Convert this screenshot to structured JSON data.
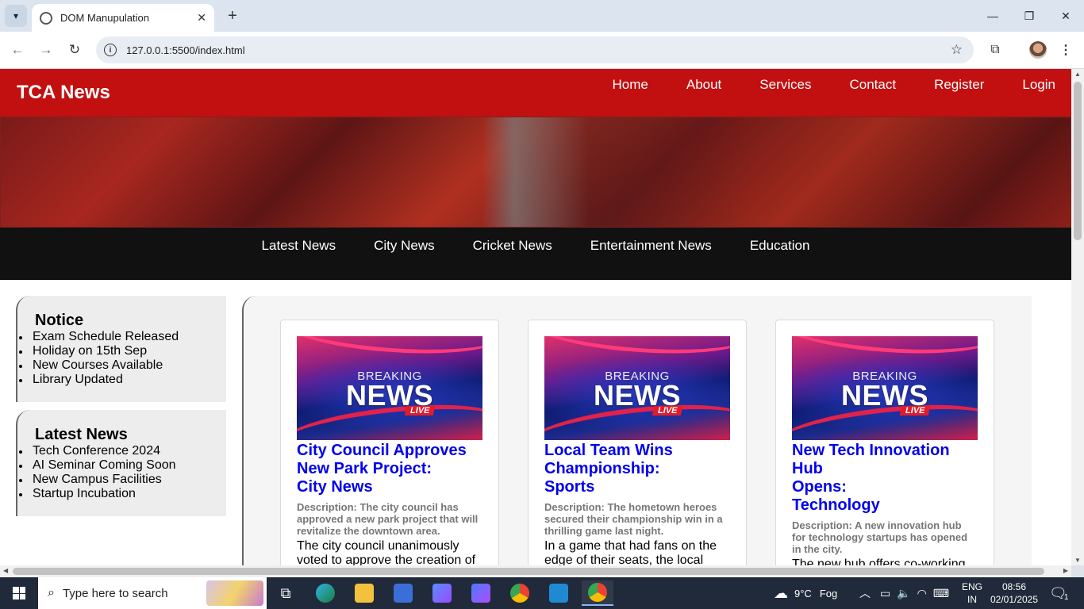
{
  "browser": {
    "tab_title": "DOM Manupulation",
    "url": "127.0.0.1:5500/index.html"
  },
  "site": {
    "logo": "TCA News",
    "main_nav": [
      "Home",
      "About",
      "Services",
      "Contact",
      "Register",
      "Login"
    ],
    "category_nav": [
      "Latest News",
      "City News",
      "Cricket News",
      "Entertainment News",
      "Education"
    ],
    "notice": {
      "title": "Notice",
      "items": [
        "Exam Schedule Released",
        "Holiday on 15th Sep",
        "New Courses Available",
        "Library Updated"
      ]
    },
    "latest": {
      "title": "Latest News",
      "items": [
        "Tech Conference 2024",
        "AI Seminar Coming Soon",
        "New Campus Facilities",
        "Startup Incubation"
      ]
    },
    "cards": [
      {
        "img_breaking": "BREAKING",
        "img_news": "NEWS",
        "img_live": "LIVE",
        "headline_line1": "City Council Approves",
        "headline_line2": "New Park Project:",
        "category": "City News",
        "description": "Description: The city council has approved a new park project that will revitalize the downtown area.",
        "body": "The city council unanimously voted to approve the creation of"
      },
      {
        "img_breaking": "BREAKING",
        "img_news": "NEWS",
        "img_live": "LIVE",
        "headline_line1": "Local Team Wins",
        "headline_line2": "Championship:",
        "category": "Sports",
        "description": "Description: The hometown heroes secured their championship win in a thrilling game last night.",
        "body": "In a game that had fans on the edge of their seats, the local"
      },
      {
        "img_breaking": "BREAKING",
        "img_news": "NEWS",
        "img_live": "LIVE",
        "headline_line1": "New Tech Innovation Hub",
        "headline_line2": "Opens:",
        "category": "Technology",
        "description": "Description: A new innovation hub for technology startups has opened in the city.",
        "body": "The new hub offers co-working spaces, mentorship programs,"
      }
    ]
  },
  "taskbar": {
    "search_placeholder": "Type here to search",
    "weather_temp": "9°C",
    "weather_text": "Fog",
    "lang_line1": "ENG",
    "lang_line2": "IN",
    "time": "08:56",
    "date": "02/01/2025",
    "notification_count": "1"
  }
}
